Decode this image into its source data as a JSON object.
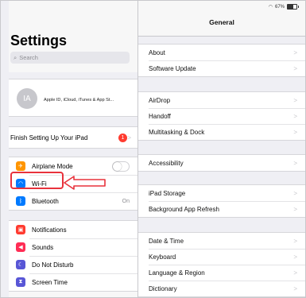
{
  "status": {
    "battery": "67%"
  },
  "sidebar": {
    "title": "Settings",
    "search_placeholder": "Search",
    "account": {
      "initials": "IA",
      "label": "Apple ID, iCloud, iTunes & App St..."
    },
    "finish_setup": {
      "label": "Finish Setting Up Your iPad",
      "badge": "1"
    },
    "items": [
      {
        "label": "Airplane Mode",
        "icon": "airplane-icon",
        "color": "#ff9500",
        "toggle": false
      },
      {
        "label": "Wi-Fi",
        "icon": "wifi-icon",
        "color": "#007aff"
      },
      {
        "label": "Bluetooth",
        "icon": "bluetooth-icon",
        "color": "#007aff",
        "value": "On"
      },
      {
        "label": "Notifications",
        "icon": "notifications-icon",
        "color": "#ff3b30"
      },
      {
        "label": "Sounds",
        "icon": "sounds-icon",
        "color": "#ff2d55"
      },
      {
        "label": "Do Not Disturb",
        "icon": "moon-icon",
        "color": "#5856d6"
      },
      {
        "label": "Screen Time",
        "icon": "hourglass-icon",
        "color": "#5856d6"
      }
    ]
  },
  "detail": {
    "title": "General",
    "groups": [
      [
        "About",
        "Software Update"
      ],
      [
        "AirDrop",
        "Handoff",
        "Multitasking & Dock"
      ],
      [
        "Accessibility"
      ],
      [
        "iPad Storage",
        "Background App Refresh"
      ],
      [
        "Date & Time",
        "Keyboard",
        "Language & Region",
        "Dictionary"
      ]
    ]
  },
  "annotation": {
    "highlight_color": "#e8323c"
  }
}
